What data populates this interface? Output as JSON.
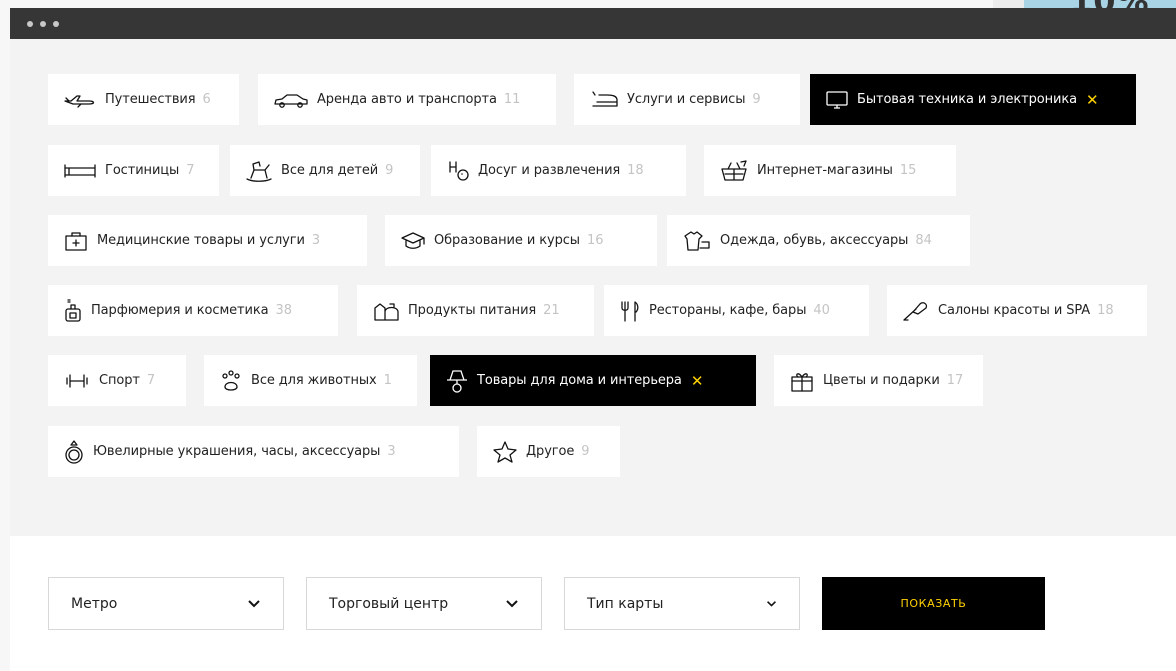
{
  "categories": [
    {
      "label": "Путешествия",
      "count": "6",
      "icon": "plane-icon"
    },
    {
      "label": "Аренда авто и транспорта",
      "count": "11",
      "icon": "car-icon"
    },
    {
      "label": "Услуги и сервисы",
      "count": "9",
      "icon": "iron-icon"
    },
    {
      "label": "Бытовая техника и электроника",
      "count": "",
      "icon": "monitor-icon",
      "active": true
    },
    {
      "label": "Гостиницы",
      "count": "7",
      "icon": "bed-icon"
    },
    {
      "label": "Все для детей",
      "count": "9",
      "icon": "rocking-horse-icon"
    },
    {
      "label": "Досуг и развлечения",
      "count": "18",
      "icon": "leisure-icon"
    },
    {
      "label": "Интернет-магазины",
      "count": "15",
      "icon": "basket-icon"
    },
    {
      "label": "Медицинские товары и услуги",
      "count": "3",
      "icon": "first-aid-icon"
    },
    {
      "label": "Образование и курсы",
      "count": "16",
      "icon": "graduation-cap-icon"
    },
    {
      "label": "Одежда, обувь, аксессуары",
      "count": "84",
      "icon": "clothes-icon"
    },
    {
      "label": "Парфюмерия и косметика",
      "count": "38",
      "icon": "perfume-icon"
    },
    {
      "label": "Продукты питания",
      "count": "21",
      "icon": "groceries-icon"
    },
    {
      "label": "Рестораны, кафе, бары",
      "count": "40",
      "icon": "fork-knife-icon"
    },
    {
      "label": "Салоны красоты и SPA",
      "count": "18",
      "icon": "brush-icon"
    },
    {
      "label": "Спорт",
      "count": "7",
      "icon": "dumbbell-icon"
    },
    {
      "label": "Все для животных",
      "count": "1",
      "icon": "paw-icon"
    },
    {
      "label": "Товары для дома и интерьера",
      "count": "",
      "icon": "lamp-icon",
      "active": true
    },
    {
      "label": "Цветы и подарки",
      "count": "17",
      "icon": "gift-icon"
    },
    {
      "label": "Ювелирные украшения, часы, аксессуары",
      "count": "3",
      "icon": "ring-icon"
    },
    {
      "label": "Другое",
      "count": "9",
      "icon": "star-icon"
    }
  ],
  "active_close": "✕",
  "filters": {
    "metro": "Метро",
    "mall": "Торговый центр",
    "card_type": "Тип карты",
    "submit": "ПОКАЗАТЬ"
  },
  "colors": {
    "accent": "#ffd200",
    "active_bg": "#000000",
    "panel": "#f2f3f2"
  }
}
